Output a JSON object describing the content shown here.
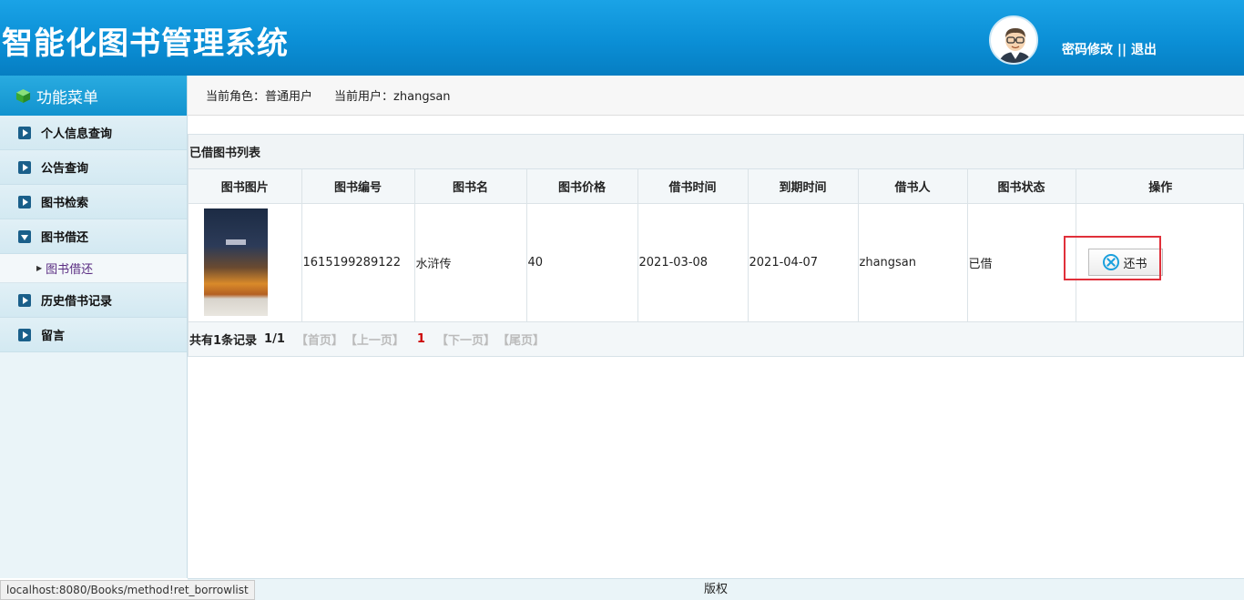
{
  "header": {
    "title": "智能化图书管理系统",
    "change_password": "密码修改",
    "separator": " || ",
    "logout": "退出"
  },
  "sidebar": {
    "title": "功能菜单",
    "items": [
      {
        "label": "个人信息查询",
        "icon": "play-icon"
      },
      {
        "label": "公告查询",
        "icon": "play-icon"
      },
      {
        "label": "图书检索",
        "icon": "play-icon"
      },
      {
        "label": "图书借还",
        "icon": "expand-icon",
        "expanded": true
      },
      {
        "label": "历史借书记录",
        "icon": "play-icon"
      },
      {
        "label": "留言",
        "icon": "play-icon"
      }
    ],
    "sub_items": [
      {
        "label": "图书借还",
        "parent": 3
      }
    ]
  },
  "infobar": {
    "role_label": "当前角色：",
    "role": "普通用户",
    "user_label": "当前用户：",
    "user": "zhangsan"
  },
  "panel": {
    "title": "已借图书列表",
    "columns": [
      "图书图片",
      "图书编号",
      "图书名",
      "图书价格",
      "借书时间",
      "到期时间",
      "借书人",
      "图书状态",
      "操作"
    ],
    "rows": [
      {
        "book_id": "1615199289122",
        "book_name": "水浒传",
        "price": "40",
        "borrow_date": "2021-03-08",
        "due_date": "2021-04-07",
        "borrower": "zhangsan",
        "status": "已借",
        "action": "还书"
      }
    ],
    "pager": {
      "total": "共有1条记录",
      "page_info": "1/1",
      "first": "【首页】",
      "prev": "【上一页】",
      "current": "1",
      "next": "【下一页】",
      "last": "【尾页】"
    }
  },
  "footer": {
    "text": "版权"
  },
  "statusbar": {
    "url": "localhost:8080/Books/method!ret_borrowlist"
  },
  "colors": {
    "header_blue": "#0b8fd6",
    "accent_red": "#e0303a",
    "link_purple": "#5a2d82"
  }
}
